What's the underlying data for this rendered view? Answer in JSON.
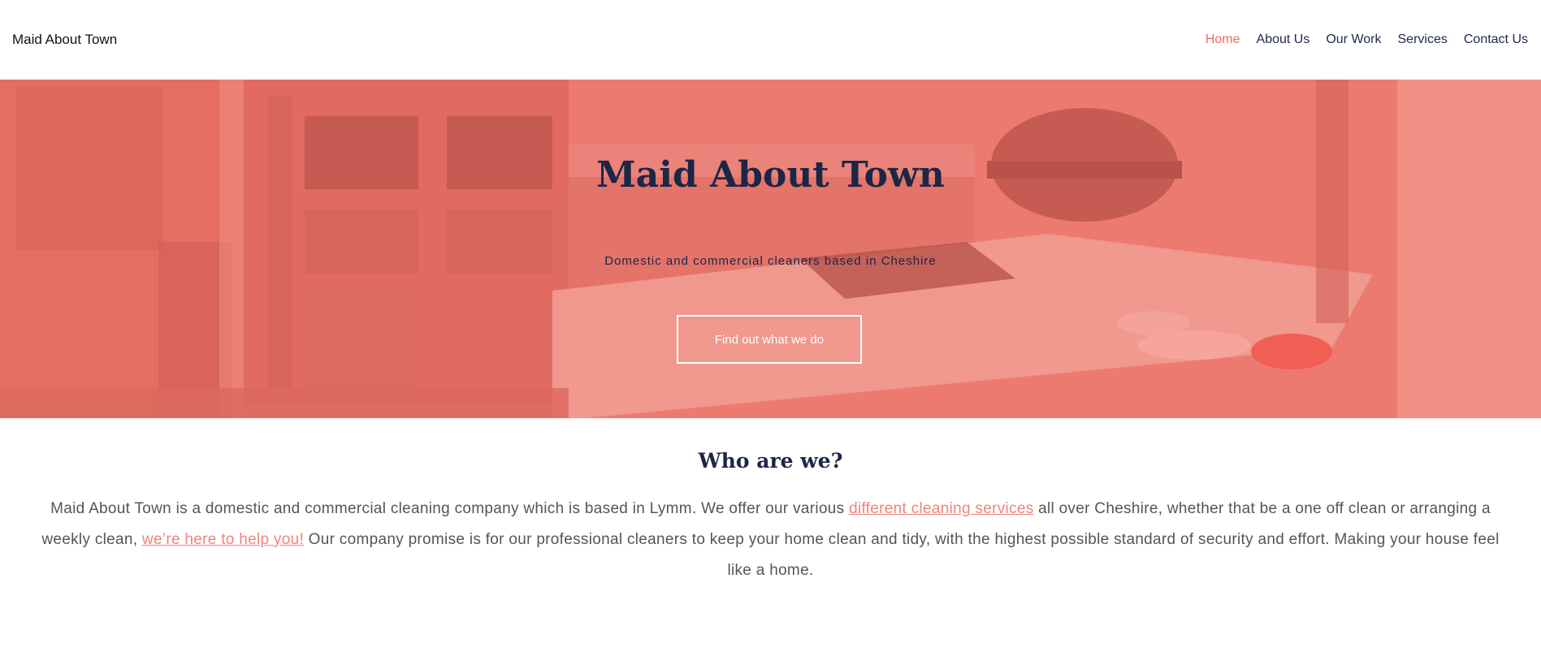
{
  "header": {
    "brand": "Maid About Town",
    "nav": [
      {
        "label": "Home",
        "active": true
      },
      {
        "label": "About Us",
        "active": false
      },
      {
        "label": "Our Work",
        "active": false
      },
      {
        "label": "Services",
        "active": false
      },
      {
        "label": "Contact Us",
        "active": false
      }
    ]
  },
  "hero": {
    "title": "Maid About Town",
    "subtitle": "Domestic and commercial cleaners based in Cheshire",
    "button_label": "Find out what we do",
    "overlay_color": "#ec7a70"
  },
  "about": {
    "title": "Who are we?",
    "text_1": "Maid About Town is a domestic and commercial cleaning company which is based in Lymm. We offer our various ",
    "link_1": "different cleaning services",
    "text_2": " all over Cheshire, whether that be a one off clean or arranging a weekly clean, ",
    "link_2": "we’re here to help you!",
    "text_3": " Our company promise is for our professional cleaners to keep your home clean and tidy, with the highest possible standard of security and effort. Making your house feel like a home."
  },
  "colors": {
    "accent": "#ef6b5e",
    "navy": "#1c2647",
    "link": "#ef857a"
  }
}
